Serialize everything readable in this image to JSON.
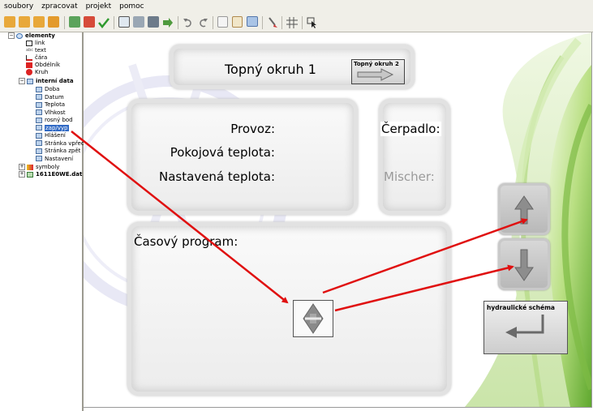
{
  "menu": [
    "soubory",
    "zpracovat",
    "projekt",
    "pomoc"
  ],
  "toolbar_icons": [
    "new-folder-icon",
    "open-folder-icon",
    "folder-icon",
    "save-icon",
    "dat-import-icon",
    "dat-export-icon",
    "check-icon",
    "monitor-icon",
    "copy-screen-icon",
    "screen-icon",
    "forward-arrow-icon",
    "undo-icon",
    "redo-icon",
    "copy-icon",
    "paste-icon",
    "image-icon",
    "brush-icon",
    "grid-icon",
    "cursor-icon"
  ],
  "tree": {
    "root": "elementy",
    "elements": [
      "link",
      "text",
      "čára",
      "Obdélník",
      "Kruh"
    ],
    "internal_label": "interní data",
    "internal": [
      "Doba",
      "Datum",
      "Teplota",
      "Vlhkost",
      "rosný bod",
      "zap/vyp",
      "Hlášení",
      "Stránka vpřed",
      "Stránka zpět",
      "Nastavení"
    ],
    "symbols": "symboly",
    "file": "1611E0WE.dat"
  },
  "screen": {
    "title": "Topný okruh 1",
    "next_button": "Topný okruh 2",
    "provoz": "Provoz:",
    "pokojova": "Pokojová teplota:",
    "nastavena": "Nastavená teplota:",
    "cerpadlo": "Čerpadlo:",
    "mischer": "Mischer:",
    "casovy": "Časový program:",
    "hydraulic": "hydraulické schéma"
  },
  "colors": {
    "arrow": "#e01010",
    "accent_green": "#8bc34a",
    "selection": "#316ac5"
  }
}
